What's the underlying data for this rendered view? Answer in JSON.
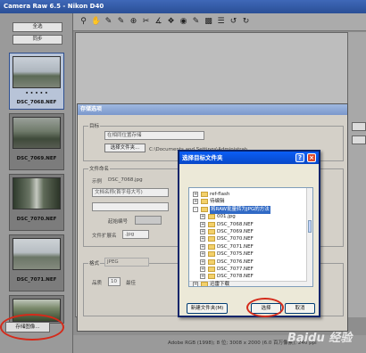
{
  "app": {
    "title": "Camera Raw 6.5 - Nikon D40"
  },
  "left": {
    "select_all": "全选",
    "sync": "同步",
    "save_images": "存储图像...",
    "thumbs": [
      {
        "name": "DSC_7068.NEF",
        "rating": "• • • • •"
      },
      {
        "name": "DSC_7069.NEF"
      },
      {
        "name": "DSC_7070.NEF"
      },
      {
        "name": "DSC_7071.NEF"
      },
      {
        "name": ""
      }
    ]
  },
  "status": {
    "text": "Adobe RGB (1998); 8 位; 3008 x 2000 (6.0 百万像素); 240 ppi"
  },
  "watermark": "Baidu 经验",
  "save_dialog": {
    "title": "存储选项",
    "target_label": "目标",
    "target_value": "在相同位置存储",
    "choose_folder": "选择文件夹...",
    "path": "C:\\Documents and Settings\\Administrator\\桌面\\NEF",
    "naming_label": "文件命名",
    "example_label": "示例",
    "example_value": "DSC_7068.jpg",
    "naming_value": "文档名称(首字母大写)",
    "start_number_label": "起始编号",
    "ext_label": "文件扩展名",
    "ext_value": ".jpg",
    "format_label": "格式",
    "format_value": "JPEG",
    "quality_label": "品质",
    "quality_value": "10",
    "quality_desc": "最佳"
  },
  "folder_dialog": {
    "title": "选择目标文件夹",
    "tree": [
      {
        "name": "ref-flash",
        "expand": "+",
        "indent": 0
      },
      {
        "name": "待编辑",
        "expand": "+",
        "indent": 0
      },
      {
        "name": "将RAW批量转为JPG的方法",
        "expand": "-",
        "indent": 0,
        "selected": true
      },
      {
        "name": "001.jpg",
        "expand": "+",
        "indent": 1
      },
      {
        "name": "DSC_7068.NEF",
        "expand": "+",
        "indent": 1
      },
      {
        "name": "DSC_7069.NEF",
        "expand": "+",
        "indent": 1
      },
      {
        "name": "DSC_7070.NEF",
        "expand": "+",
        "indent": 1
      },
      {
        "name": "DSC_7071.NEF",
        "expand": "+",
        "indent": 1
      },
      {
        "name": "DSC_7075.NEF",
        "expand": "+",
        "indent": 1
      },
      {
        "name": "DSC_7076.NEF",
        "expand": "+",
        "indent": 1
      },
      {
        "name": "DSC_7077.NEF",
        "expand": "+",
        "indent": 1
      },
      {
        "name": "DSC_7078.NEF",
        "expand": "+",
        "indent": 1
      },
      {
        "name": "迅雷下载",
        "expand": "+",
        "indent": 0
      }
    ],
    "new_folder": "新建文件夹(M)",
    "select": "选择",
    "cancel": "取消"
  }
}
